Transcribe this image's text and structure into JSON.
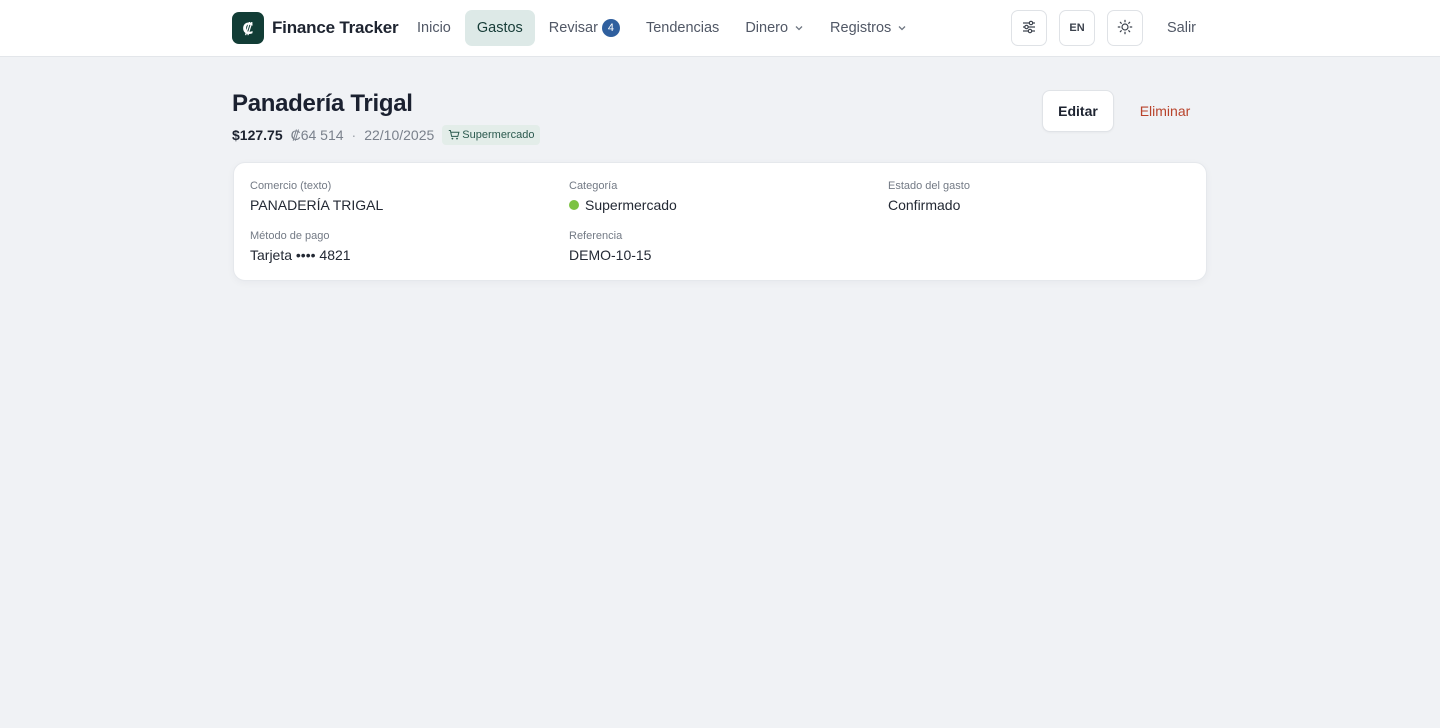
{
  "app": {
    "name": "Finance Tracker",
    "logo_glyph": "₡"
  },
  "nav": {
    "items": [
      {
        "label": "Inicio",
        "active": false
      },
      {
        "label": "Gastos",
        "active": true
      },
      {
        "label": "Revisar",
        "badge": "4",
        "active": false
      },
      {
        "label": "Tendencias",
        "active": false
      },
      {
        "label": "Dinero",
        "dropdown": true,
        "active": false
      },
      {
        "label": "Registros",
        "dropdown": true,
        "active": false
      }
    ]
  },
  "tools": {
    "filters_icon": "sliders-icon",
    "language": "EN",
    "theme_icon": "sun-icon",
    "logout": "Salir"
  },
  "expense": {
    "title": "Panadería Trigal",
    "amount": "$127.75",
    "amount_alt": "₡64 514",
    "separator": "·",
    "date": "22/10/2025",
    "category_pill": "Supermercado",
    "category_pill_icon": "cart-icon"
  },
  "actions": {
    "edit": "Editar",
    "delete": "Eliminar"
  },
  "details": {
    "merchant_label": "Comercio (texto)",
    "merchant_value": "PANADERÍA TRIGAL",
    "category_label": "Categoría",
    "category_value": "Supermercado",
    "category_color": "#7cc242",
    "status_label": "Estado del gasto",
    "status_value": "Confirmado",
    "payment_label": "Método de pago",
    "payment_value": "Tarjeta •••• 4821",
    "reference_label": "Referencia",
    "reference_value": "DEMO-10-15"
  },
  "colors": {
    "brand": "#123d36",
    "active_nav": "#dde9e7",
    "badge": "#2f5f9e",
    "danger": "#b8432b"
  }
}
